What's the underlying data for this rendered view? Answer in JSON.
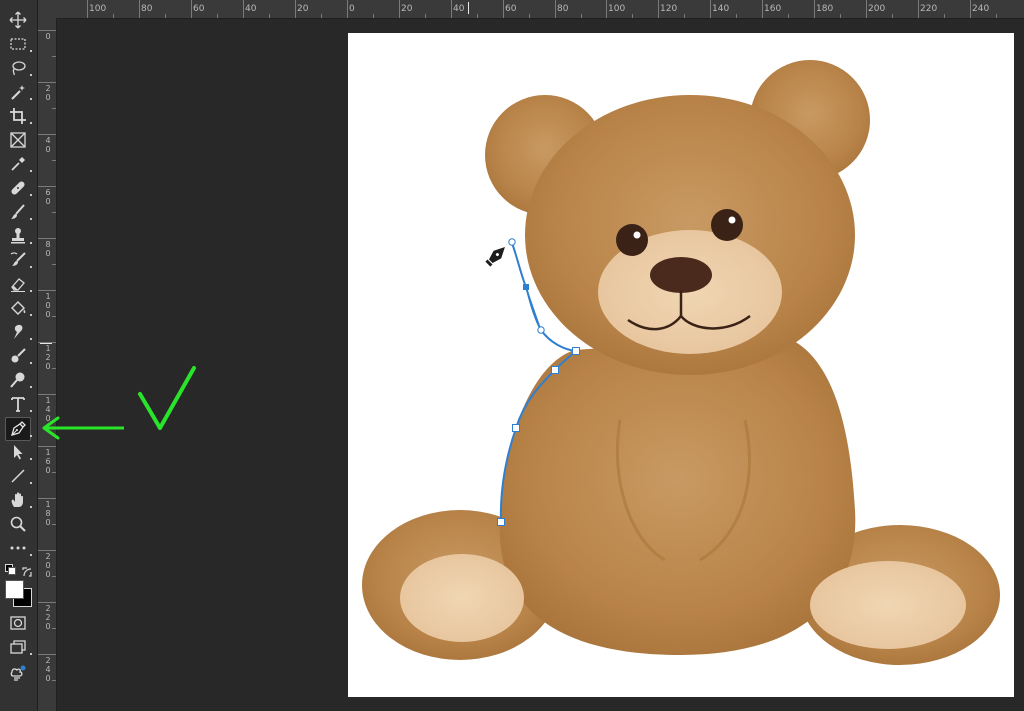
{
  "toolbar": {
    "tools": [
      {
        "name": "move-tool",
        "icon": "move-icon"
      },
      {
        "name": "marquee-tool",
        "icon": "marquee-icon"
      },
      {
        "name": "lasso-tool",
        "icon": "lasso-icon"
      },
      {
        "name": "magic-wand-tool",
        "icon": "magic-wand-icon"
      },
      {
        "name": "crop-tool",
        "icon": "crop-icon"
      },
      {
        "name": "frame-tool",
        "icon": "frame-icon"
      },
      {
        "name": "eyedropper-tool",
        "icon": "eyedropper-icon"
      },
      {
        "name": "healing-brush-tool",
        "icon": "bandage-icon"
      },
      {
        "name": "brush-tool",
        "icon": "brush-icon"
      },
      {
        "name": "clone-stamp-tool",
        "icon": "stamp-icon"
      },
      {
        "name": "history-brush-tool",
        "icon": "history-brush-icon"
      },
      {
        "name": "eraser-tool",
        "icon": "eraser-icon"
      },
      {
        "name": "paint-bucket-tool",
        "icon": "paint-bucket-icon"
      },
      {
        "name": "smudge-tool",
        "icon": "smudge-icon"
      },
      {
        "name": "dodge-tool",
        "icon": "dodge-icon"
      },
      {
        "name": "type-tool",
        "icon": "type-icon",
        "label": "T"
      },
      {
        "name": "pen-tool",
        "icon": "pen-icon",
        "active": true
      },
      {
        "name": "path-selection-tool",
        "icon": "arrow-icon"
      },
      {
        "name": "line-tool",
        "icon": "line-icon"
      },
      {
        "name": "hand-tool",
        "icon": "hand-icon"
      },
      {
        "name": "zoom-tool",
        "icon": "zoom-icon"
      },
      {
        "name": "more-tools",
        "icon": "ellipsis-icon",
        "label": "•••"
      },
      {
        "name": "color-swatches",
        "icon": "swatches-icon"
      },
      {
        "name": "quick-mask-mode",
        "icon": "quick-mask-icon"
      },
      {
        "name": "screen-mode",
        "icon": "screen-mode-icon"
      },
      {
        "name": "share",
        "icon": "share-icon"
      }
    ],
    "foreground_color": "#ffffff",
    "background_color": "#000000"
  },
  "rulers": {
    "horizontal_labels": [
      "100",
      "80",
      "60",
      "40",
      "20",
      "0",
      "20",
      "40",
      "60",
      "80",
      "100",
      "120",
      "140",
      "160",
      "180",
      "200",
      "220",
      "240"
    ],
    "vertical_labels": [
      "0",
      "20",
      "40",
      "60",
      "80",
      "100",
      "120",
      "140",
      "160",
      "180",
      "200",
      "220",
      "240"
    ]
  },
  "annotation": {
    "arrow_color": "#29e529",
    "checkmark_color": "#29e529",
    "points_to": "pen-tool"
  },
  "path": {
    "color": "#2f7fd1"
  }
}
